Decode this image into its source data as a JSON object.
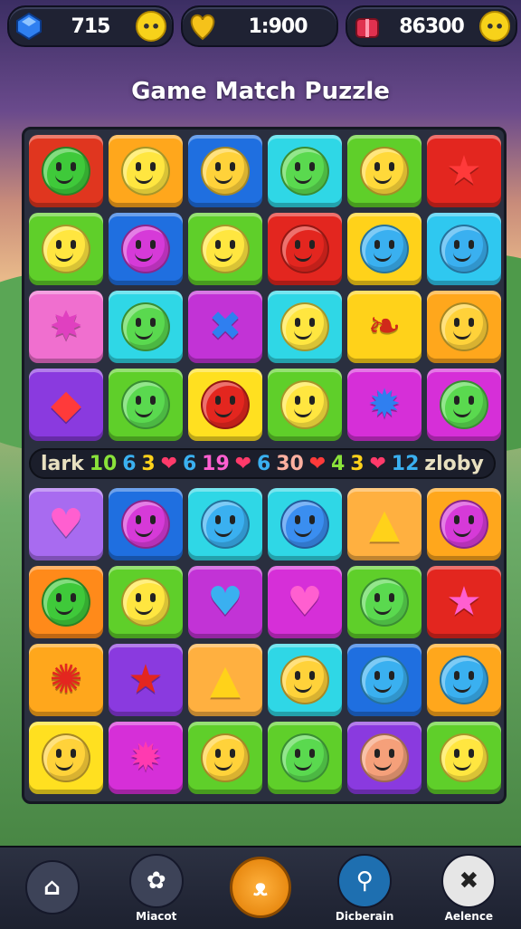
{
  "hud": [
    {
      "icon": "blue-gem-icon",
      "value": "715",
      "color": "#2f7ff0"
    },
    {
      "icon": "gold-heart-icon",
      "value": "1:900",
      "color": "#f5c21a"
    },
    {
      "icon": "red-gift-icon",
      "value": "86300",
      "color": "#e0314f"
    }
  ],
  "title": "Game Match Puzzle",
  "board_top": [
    [
      {
        "c": "#e0361f",
        "k": "face",
        "f": "#3fc93a"
      },
      {
        "c": "#ffa71c",
        "k": "face",
        "f": "#ffe640"
      },
      {
        "c": "#1f6fe0",
        "k": "face",
        "f": "#ffd23a"
      },
      {
        "c": "#2fd7e6",
        "k": "face",
        "f": "#5ad94f"
      },
      {
        "c": "#5fcf2a",
        "k": "face",
        "f": "#ffd93a"
      },
      {
        "c": "#e3261f",
        "k": "shape",
        "s": "★",
        "sc": "#ff3a3a"
      }
    ],
    [
      {
        "c": "#5fcf2a",
        "k": "face",
        "f": "#ffe640"
      },
      {
        "c": "#1f6fe0",
        "k": "face",
        "f": "#d63ad8"
      },
      {
        "c": "#5fcf2a",
        "k": "face",
        "f": "#ffe640"
      },
      {
        "c": "#e3261f",
        "k": "face",
        "f": "#e3261f"
      },
      {
        "c": "#ffd21a",
        "k": "face",
        "f": "#3ab0f0"
      },
      {
        "c": "#2fc8f0",
        "k": "face",
        "f": "#3ab0f0"
      }
    ],
    [
      {
        "c": "#f06fcf",
        "k": "shape",
        "s": "✸",
        "sc": "#e040c0"
      },
      {
        "c": "#2fd7e6",
        "k": "face",
        "f": "#5ad94f"
      },
      {
        "c": "#c233d6",
        "k": "shape",
        "s": "✖",
        "sc": "#2f7ff0"
      },
      {
        "c": "#2fd7e6",
        "k": "face",
        "f": "#ffe640"
      },
      {
        "c": "#ffd21a",
        "k": "shape",
        "s": "❧",
        "sc": "#d02a1a"
      },
      {
        "c": "#ffa71c",
        "k": "face",
        "f": "#ffd23a"
      }
    ],
    [
      {
        "c": "#8a3adf",
        "k": "shape",
        "s": "◆",
        "sc": "#ff3a3a"
      },
      {
        "c": "#5fcf2a",
        "k": "face",
        "f": "#5ad94f"
      },
      {
        "c": "#ffe020",
        "k": "face",
        "f": "#e3261f"
      },
      {
        "c": "#5fcf2a",
        "k": "face",
        "f": "#ffe640"
      },
      {
        "c": "#d62fd8",
        "k": "shape",
        "s": "✹",
        "sc": "#2f7ff0"
      },
      {
        "c": "#d62fd8",
        "k": "face",
        "f": "#5ad94f"
      }
    ]
  ],
  "strip": [
    "lark",
    "10",
    "6",
    "3",
    "❤",
    "6",
    "19",
    "❤",
    "6",
    "30",
    "❤",
    "4",
    "3",
    "❤",
    "12",
    "zloby"
  ],
  "board_bottom": [
    [
      {
        "c": "#a86bf0",
        "k": "shape",
        "s": "♥",
        "sc": "#ff5fd0"
      },
      {
        "c": "#1f6fe0",
        "k": "face",
        "f": "#d63ad8"
      },
      {
        "c": "#2fd7e6",
        "k": "face",
        "f": "#3ab0f0"
      },
      {
        "c": "#2fd7e6",
        "k": "face",
        "f": "#3a8ef0"
      },
      {
        "c": "#ffb040",
        "k": "shape",
        "s": "▲",
        "sc": "#ffd21a"
      },
      {
        "c": "#ffa71c",
        "k": "face",
        "f": "#d63ad8"
      }
    ],
    [
      {
        "c": "#ff8a1a",
        "k": "face",
        "f": "#3fc93a"
      },
      {
        "c": "#5fcf2a",
        "k": "face",
        "f": "#ffe640"
      },
      {
        "c": "#c233d6",
        "k": "shape",
        "s": "♥",
        "sc": "#3ab0f0"
      },
      {
        "c": "#d62fd8",
        "k": "shape",
        "s": "♥",
        "sc": "#ff5fd0"
      },
      {
        "c": "#5fcf2a",
        "k": "face",
        "f": "#5ad94f"
      },
      {
        "c": "#e3261f",
        "k": "shape",
        "s": "★",
        "sc": "#ff5fd0"
      }
    ],
    [
      {
        "c": "#ffa71c",
        "k": "shape",
        "s": "✺",
        "sc": "#e3261f"
      },
      {
        "c": "#8a3adf",
        "k": "shape",
        "s": "★",
        "sc": "#e3261f"
      },
      {
        "c": "#ffb040",
        "k": "shape",
        "s": "▲",
        "sc": "#ffd21a"
      },
      {
        "c": "#2fd7e6",
        "k": "face",
        "f": "#ffd23a"
      },
      {
        "c": "#1f6fe0",
        "k": "face",
        "f": "#3ab0f0"
      },
      {
        "c": "#ffa71c",
        "k": "face",
        "f": "#3ab0f0"
      }
    ],
    [
      {
        "c": "#ffe020",
        "k": "face",
        "f": "#ffd23a"
      },
      {
        "c": "#d62fd8",
        "k": "shape",
        "s": "✹",
        "sc": "#ff3ab0"
      },
      {
        "c": "#5fcf2a",
        "k": "face",
        "f": "#ffd23a"
      },
      {
        "c": "#5fcf2a",
        "k": "face",
        "f": "#5ad94f"
      },
      {
        "c": "#8a3adf",
        "k": "face",
        "f": "#f5a07a"
      },
      {
        "c": "#5fcf2a",
        "k": "face",
        "f": "#ffe640"
      }
    ]
  ],
  "nav": [
    {
      "label": "",
      "icon": "house-leaf-icon",
      "glyph": "⌂"
    },
    {
      "label": "Miacot",
      "icon": "paw-icon",
      "glyph": "✿"
    },
    {
      "label": "",
      "icon": "face-button-icon",
      "glyph": "ᴥ"
    },
    {
      "label": "Dicberain",
      "icon": "search-icon",
      "glyph": "⚲"
    },
    {
      "label": "Aelence",
      "icon": "close-icon",
      "glyph": "✖"
    }
  ]
}
